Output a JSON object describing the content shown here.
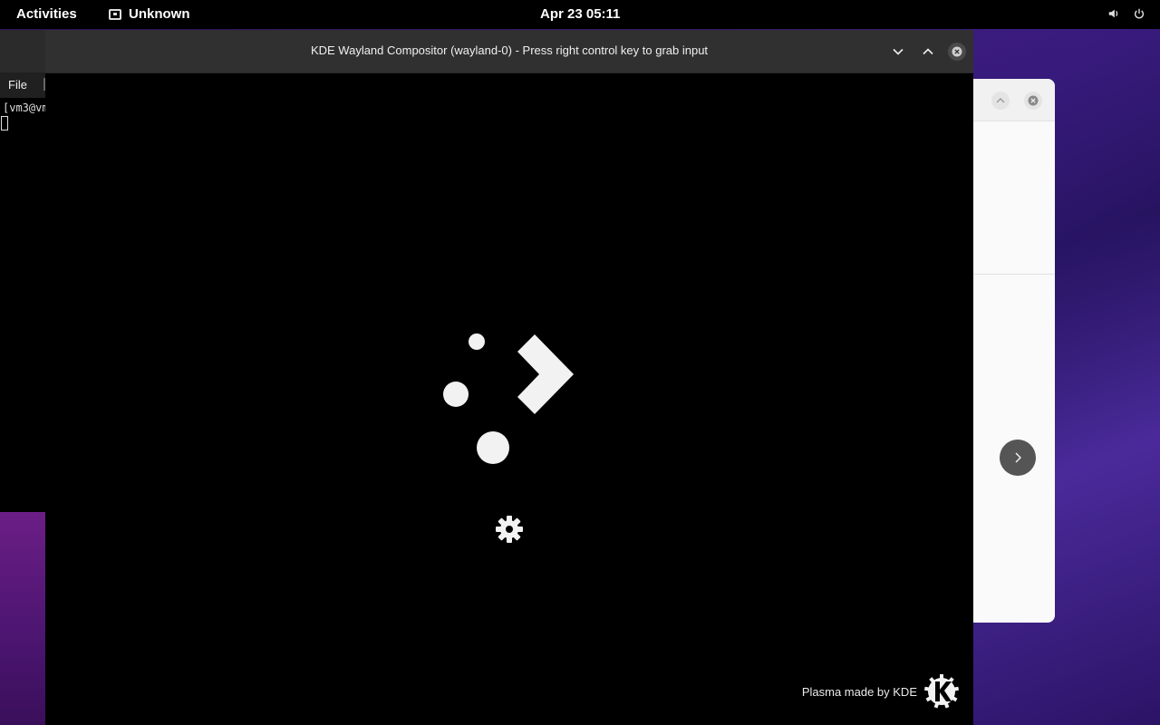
{
  "topbar": {
    "activities": "Activities",
    "app_name": "Unknown",
    "app_icon": "window-icon",
    "clock": "Apr 23  05:11",
    "volume_icon": "volume-icon",
    "power_icon": "power-icon"
  },
  "terminal": {
    "menu_file": "File",
    "prompt": "[vm3@vm",
    "cursor": ""
  },
  "kde_window": {
    "title": "KDE Wayland Compositor (wayland-0) - Press right control key to grab input",
    "buttons": [
      "minimize",
      "maximize",
      "close"
    ]
  },
  "splash": {
    "logo_icon": "plasma-logo-icon",
    "busy_icon": "gear-icon",
    "footer_text": "Plasma made by KDE",
    "footer_icon": "kde-logo-icon"
  },
  "right_window": {
    "buttons": [
      "maximize",
      "close"
    ],
    "next_icon": "chevron-right-icon"
  },
  "colors": {
    "topbar_bg": "#000000",
    "titlebar_bg": "#303030",
    "splash_bg": "#000000",
    "splash_fg": "#f2f2f2"
  }
}
